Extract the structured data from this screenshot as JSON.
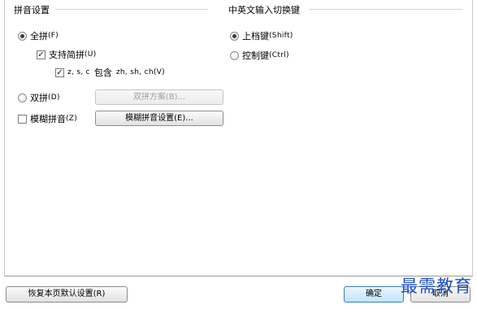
{
  "pinyin_settings": {
    "group_title": "拼音设置",
    "full_pinyin_label": "全拼",
    "full_pinyin_key": "(F)",
    "support_abbrev_label": "支持简拼",
    "support_abbrev_key": "(U)",
    "zsc_prefix": "z, s, c",
    "zsc_contains": "包含",
    "zsc_suffix": "zh, sh, ch",
    "zsc_key": "(V)",
    "double_pinyin_label": "双拼",
    "double_pinyin_key": "(D)",
    "double_scheme_button": "双拼方案(B)...",
    "fuzzy_pinyin_label": "模糊拼音",
    "fuzzy_pinyin_key": "(Z)",
    "fuzzy_settings_button": "模糊拼音设置(E)..."
  },
  "switch_settings": {
    "group_title": "中英文输入切换键",
    "shift_label": "上档键",
    "shift_key": "(Shift)",
    "ctrl_label": "控制键",
    "ctrl_key": "(Ctrl)"
  },
  "footer": {
    "restore_defaults_button": "恢复本页默认设置(R)",
    "ok_button": "确定",
    "cancel_button": "取消"
  },
  "watermark": "最需教育",
  "state": {
    "full_pinyin_selected": true,
    "support_abbrev_checked": true,
    "zsc_checked": true,
    "double_pinyin_selected": false,
    "fuzzy_pinyin_checked": false,
    "shift_selected": true,
    "ctrl_selected": false
  }
}
